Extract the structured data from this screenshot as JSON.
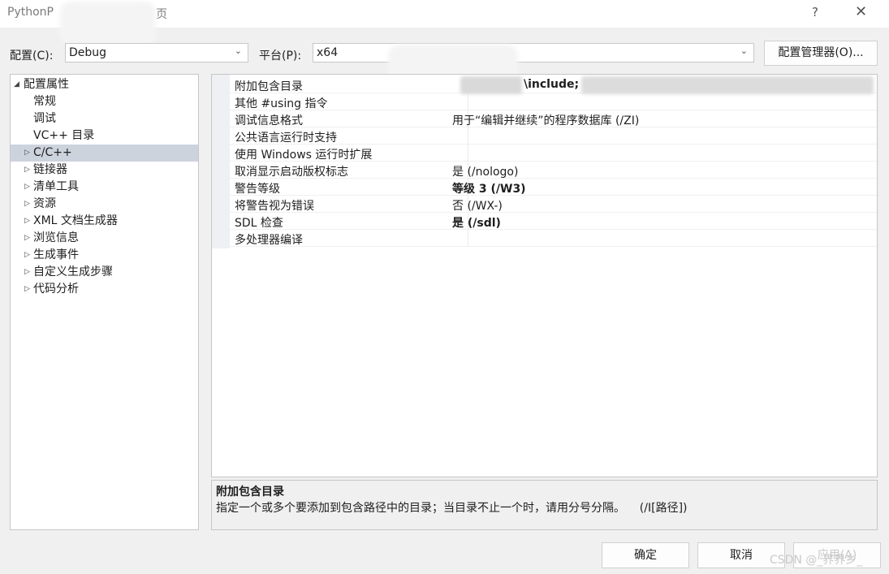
{
  "window": {
    "title": "PythonP",
    "title_suffix": "页",
    "help": "?",
    "close": "✕"
  },
  "toolbar": {
    "config_label": "配置(C):",
    "config_value": "Debug",
    "platform_label": "平台(P):",
    "platform_value": "x64",
    "config_manager_button": "配置管理器(O)..."
  },
  "tree": {
    "root": "配置属性",
    "items": [
      "常规",
      "调试",
      "VC++ 目录",
      "C/C++",
      "链接器",
      "清单工具",
      "资源",
      "XML 文档生成器",
      "浏览信息",
      "生成事件",
      "自定义生成步骤",
      "代码分析"
    ],
    "selected": "C/C++"
  },
  "properties": [
    {
      "name": "附加包含目录",
      "value": "\\include;"
    },
    {
      "name": "其他 #using 指令",
      "value": ""
    },
    {
      "name": "调试信息格式",
      "value": "用于“编辑并继续”的程序数据库 (/ZI)"
    },
    {
      "name": "公共语言运行时支持",
      "value": ""
    },
    {
      "name": "使用 Windows 运行时扩展",
      "value": ""
    },
    {
      "name": "取消显示启动版权标志",
      "value": "是 (/nologo)"
    },
    {
      "name": "警告等级",
      "value": "等级 3 (/W3)"
    },
    {
      "name": "将警告视为错误",
      "value": "否 (/WX-)"
    },
    {
      "name": "SDL 检查",
      "value": "是 (/sdl)"
    },
    {
      "name": "多处理器编译",
      "value": ""
    }
  ],
  "description": {
    "title": "附加包含目录",
    "text": "指定一个或多个要添加到包含路径中的目录；当目录不止一个时，请用分号分隔。    (/I[路径])"
  },
  "buttons": {
    "ok": "确定",
    "cancel": "取消",
    "apply": "应用(A)"
  },
  "watermark": "CSDN @_界界乡_"
}
